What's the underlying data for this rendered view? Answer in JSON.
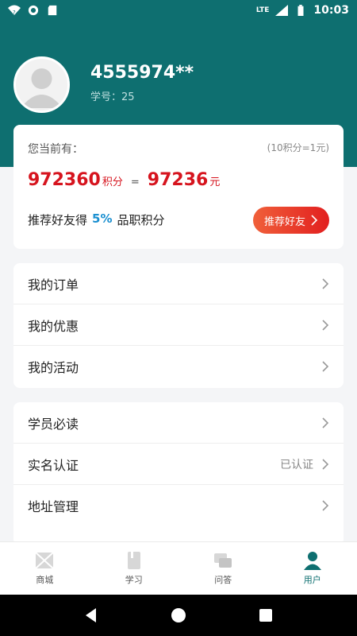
{
  "status_bar": {
    "time": "10:03",
    "network": "LTE"
  },
  "profile": {
    "username": "4555974**",
    "student_id": "学号：25"
  },
  "points": {
    "title": "您当前有：",
    "rate": "(10积分=1元)",
    "points_value": "972360",
    "points_unit": "积分",
    "equals": "=",
    "money_value": "97236",
    "money_unit": "元",
    "invite_prefix": "推荐好友得",
    "invite_percent": "5%",
    "invite_suffix": "品职积分",
    "invite_button": "推荐好友"
  },
  "menu_group_1": [
    {
      "label": "我的订单"
    },
    {
      "label": "我的优惠"
    },
    {
      "label": "我的活动"
    }
  ],
  "menu_group_2": [
    {
      "label": "学员必读",
      "aux": ""
    },
    {
      "label": "实名认证",
      "aux": "已认证"
    },
    {
      "label": "地址管理",
      "aux": ""
    }
  ],
  "tabs": [
    {
      "label": "商城",
      "icon": "mall-icon"
    },
    {
      "label": "学习",
      "icon": "study-icon"
    },
    {
      "label": "问答",
      "icon": "qa-icon"
    },
    {
      "label": "用户",
      "icon": "user-icon",
      "active": true
    }
  ],
  "colors": {
    "header": "#0e6f70",
    "accent_red": "#d6141e",
    "percent_blue": "#1a8fd0"
  }
}
